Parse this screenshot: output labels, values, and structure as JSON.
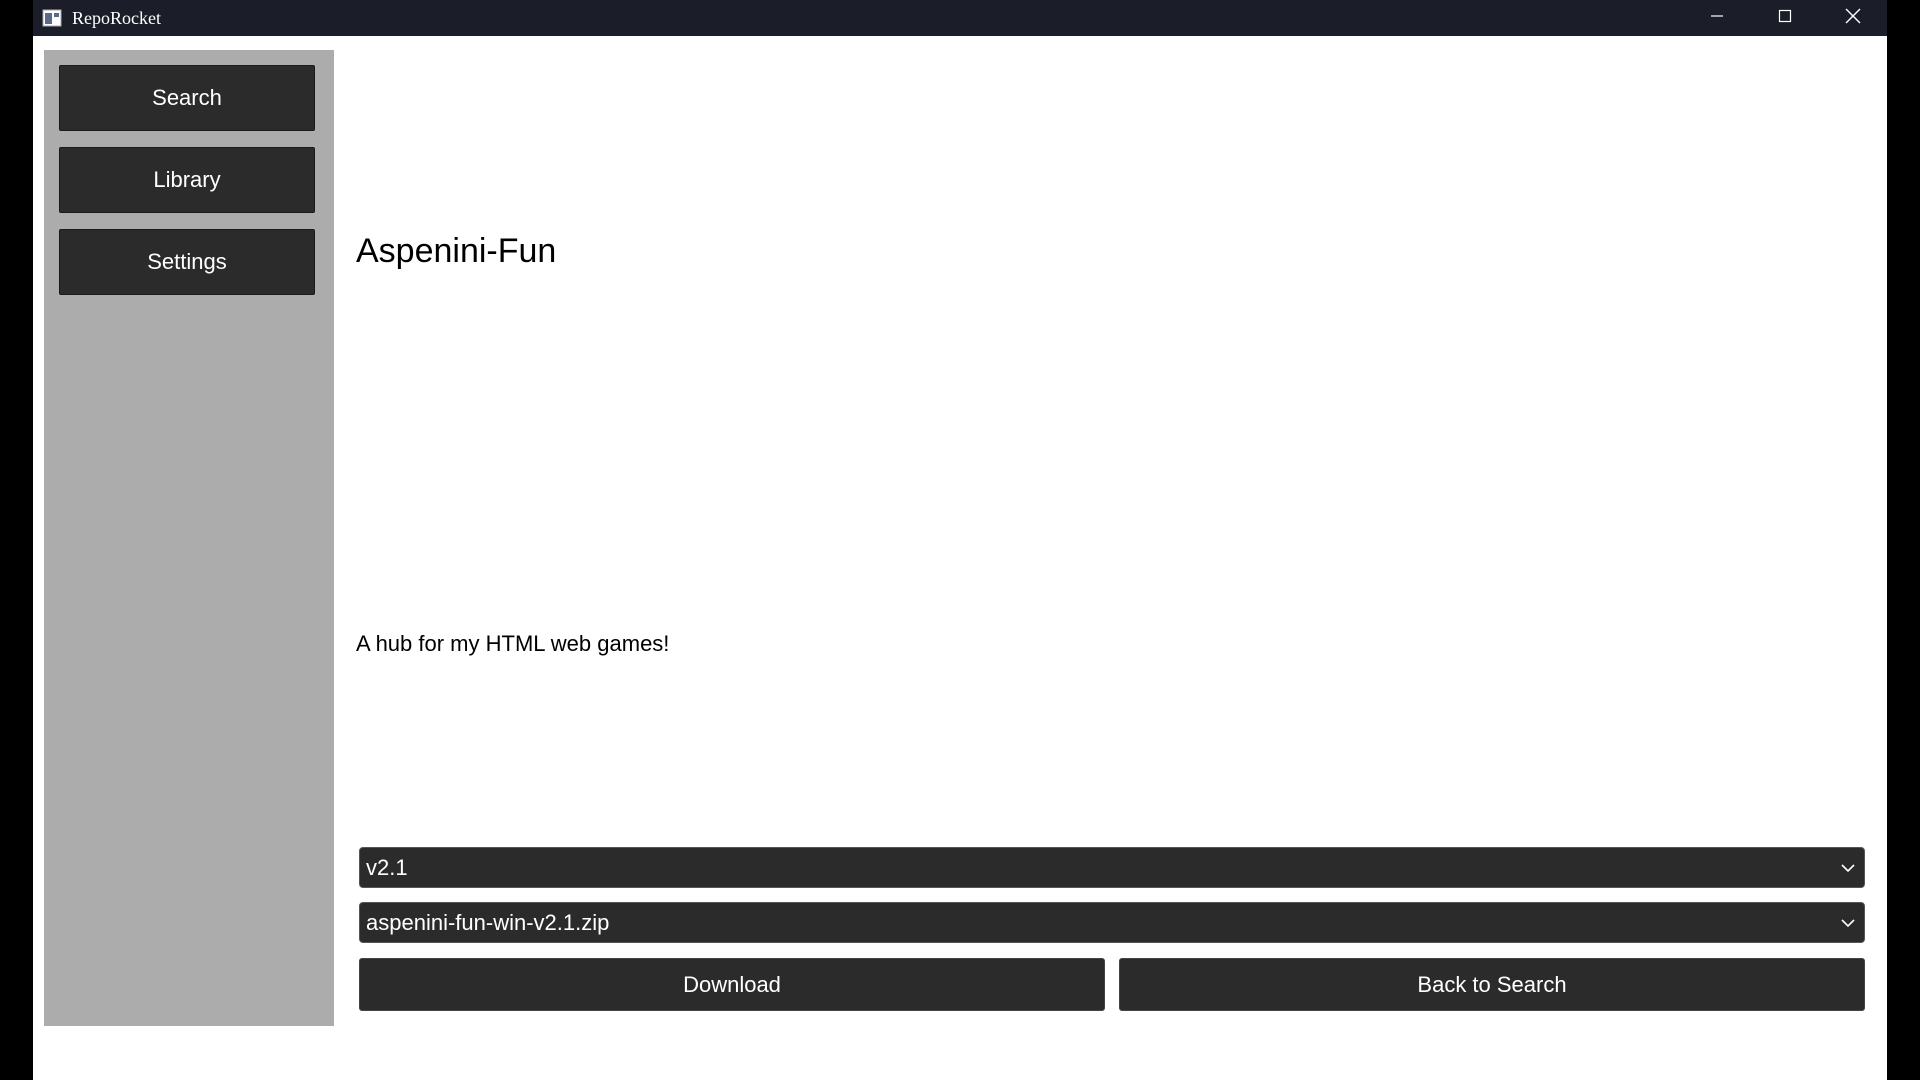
{
  "window": {
    "title": "RepoRocket",
    "app_icon": "app-window-icon",
    "controls": [
      "minimize-icon",
      "maximize-icon",
      "close-icon"
    ]
  },
  "sidebar": {
    "items": [
      {
        "label": "Search"
      },
      {
        "label": "Library"
      },
      {
        "label": "Settings"
      }
    ]
  },
  "repo": {
    "name": "Aspenini-Fun",
    "description": "A hub for my HTML web games!"
  },
  "version_select": {
    "value": "v2.1"
  },
  "asset_select": {
    "value": "aspenini-fun-win-v2.1.zip"
  },
  "actions": {
    "download_label": "Download",
    "back_label": "Back to Search"
  },
  "colors": {
    "titlebar": "#1b1e28",
    "sidebar": "#acacac",
    "button": "#2b2b2b",
    "background": "#ffffff"
  }
}
